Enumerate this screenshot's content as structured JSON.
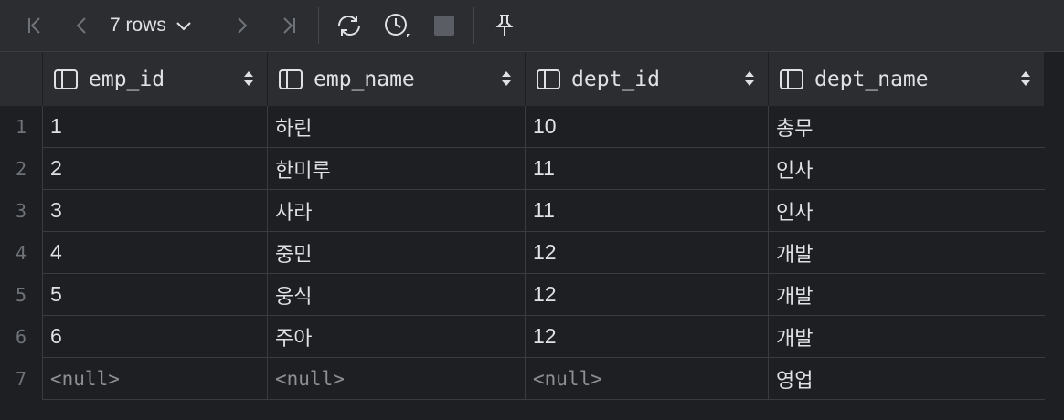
{
  "toolbar": {
    "rows_label": "7 rows",
    "buttons": [
      "first-page-icon",
      "prev-page-icon",
      "next-page-icon",
      "last-page-icon",
      "refresh-icon",
      "history-icon",
      "stop-icon",
      "pin-icon"
    ]
  },
  "table": {
    "columns": [
      "emp_id",
      "emp_name",
      "dept_id",
      "dept_name"
    ],
    "rows": [
      {
        "num": "1",
        "emp_id": "1",
        "emp_name": "하린",
        "dept_id": "10",
        "dept_name": "총무"
      },
      {
        "num": "2",
        "emp_id": "2",
        "emp_name": "한미루",
        "dept_id": "11",
        "dept_name": "인사"
      },
      {
        "num": "3",
        "emp_id": "3",
        "emp_name": "사라",
        "dept_id": "11",
        "dept_name": "인사"
      },
      {
        "num": "4",
        "emp_id": "4",
        "emp_name": "중민",
        "dept_id": "12",
        "dept_name": "개발"
      },
      {
        "num": "5",
        "emp_id": "5",
        "emp_name": "웅식",
        "dept_id": "12",
        "dept_name": "개발"
      },
      {
        "num": "6",
        "emp_id": "6",
        "emp_name": "주아",
        "dept_id": "12",
        "dept_name": "개발"
      },
      {
        "num": "7",
        "emp_id": "<null>",
        "emp_name": "<null>",
        "dept_id": "<null>",
        "dept_name": "영업"
      }
    ]
  },
  "colors": {
    "background": "#1e1f22",
    "toolbar": "#2b2d30",
    "text": "#dfe1e5",
    "muted": "#6f737a",
    "null_text": "#8c8f94"
  }
}
